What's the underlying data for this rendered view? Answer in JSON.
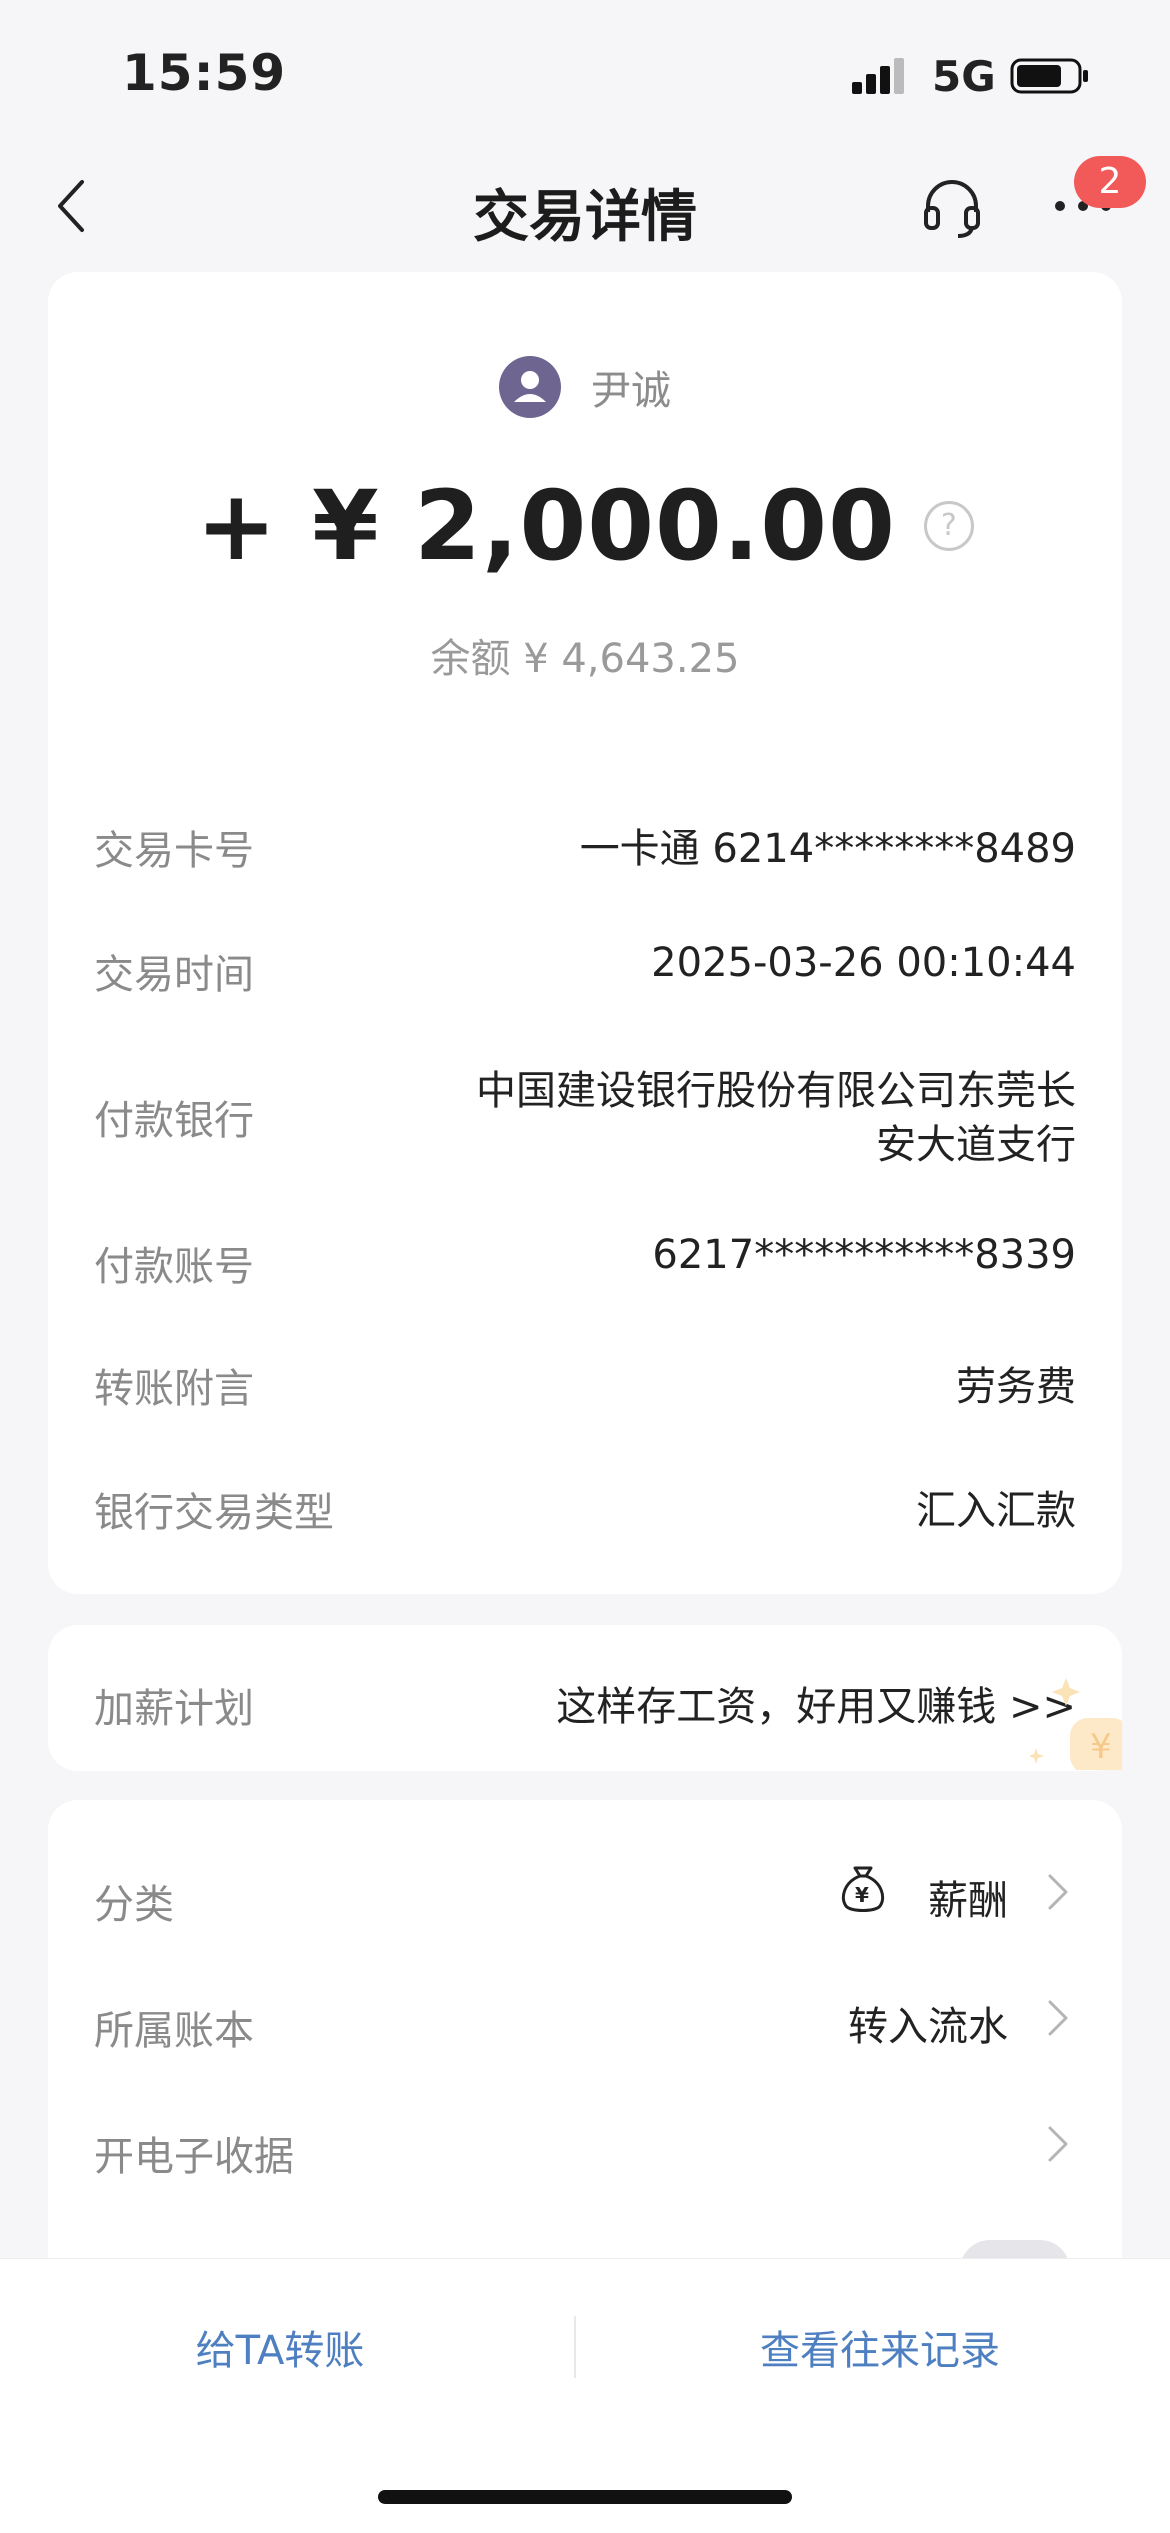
{
  "status_bar": {
    "time": "15:59",
    "network": "5G"
  },
  "nav": {
    "title": "交易详情",
    "badge_count": "2"
  },
  "summary": {
    "payer_name": "尹诚",
    "amount": "+ ¥ 2,000.00",
    "help_symbol": "?",
    "balance": "余额 ¥ 4,643.25"
  },
  "details": [
    {
      "label": "交易卡号",
      "value": "一卡通 6214********8489"
    },
    {
      "label": "交易时间",
      "value": "2025-03-26 00:10:44"
    },
    {
      "label": "付款银行",
      "value_line1": "中国建设银行股份有限公司东莞长",
      "value_line2": "安大道支行"
    },
    {
      "label": "付款账号",
      "value": "6217***********8339"
    },
    {
      "label": "转账附言",
      "value": "劳务费"
    },
    {
      "label": "银行交易类型",
      "value": "汇入汇款"
    }
  ],
  "promo": {
    "label": "加薪计划",
    "text": "这样存工资，好用又赚钱 >>"
  },
  "settings": [
    {
      "label": "分类",
      "value": "薪酬"
    },
    {
      "label": "所属账本",
      "value": "转入流水"
    },
    {
      "label": "开电子收据",
      "value": ""
    }
  ],
  "bottom": {
    "transfer_button": "给TA转账",
    "history_button": "查看往来记录"
  },
  "colors": {
    "accent_blue": "#4e7fc1",
    "badge_red": "#f25a5a",
    "avatar_purple": "#6e6591"
  }
}
